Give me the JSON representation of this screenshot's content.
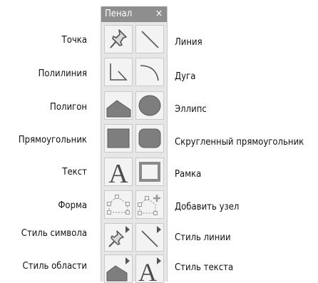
{
  "panel": {
    "title": "Пенал",
    "close": "×"
  },
  "tools": [
    {
      "id": "point",
      "label": "Точка",
      "icon": "pushpin-icon"
    },
    {
      "id": "line",
      "label": "Линия",
      "icon": "line-icon"
    },
    {
      "id": "polyline",
      "label": "Полилиния",
      "icon": "polyline-icon"
    },
    {
      "id": "arc",
      "label": "Дуга",
      "icon": "arc-icon"
    },
    {
      "id": "polygon",
      "label": "Полигон",
      "icon": "polygon-icon"
    },
    {
      "id": "ellipse",
      "label": "Эллипс",
      "icon": "ellipse-icon"
    },
    {
      "id": "rectangle",
      "label": "Прямоугольник",
      "icon": "rectangle-icon"
    },
    {
      "id": "rounded-rectangle",
      "label": "Скругленный прямоугольник",
      "icon": "rounded-rectangle-icon"
    },
    {
      "id": "text",
      "label": "Текст",
      "icon": "text-a-icon"
    },
    {
      "id": "frame",
      "label": "Рамка",
      "icon": "frame-icon"
    },
    {
      "id": "reshape",
      "label": "Форма",
      "icon": "reshape-nodes-icon"
    },
    {
      "id": "add-node",
      "label": "Добавить узел",
      "icon": "add-node-icon"
    },
    {
      "id": "symbol-style",
      "label": "Стиль символа",
      "icon": "symbol-style-icon"
    },
    {
      "id": "line-style",
      "label": "Стиль линии",
      "icon": "line-style-icon"
    },
    {
      "id": "region-style",
      "label": "Стиль области",
      "icon": "region-style-icon"
    },
    {
      "id": "text-style",
      "label": "Стиль текста",
      "icon": "text-style-icon"
    }
  ]
}
